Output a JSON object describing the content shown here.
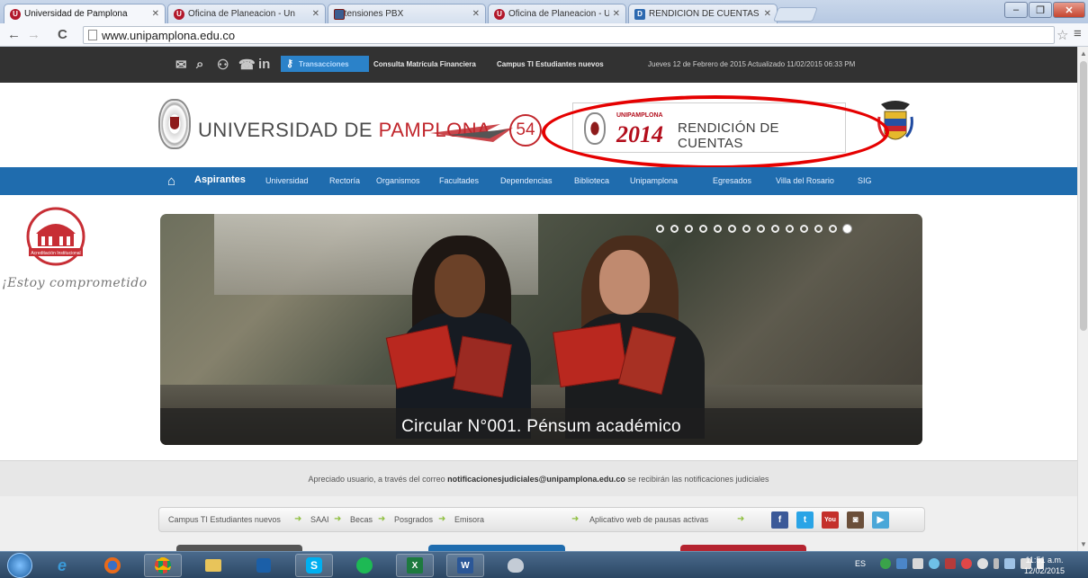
{
  "browser": {
    "tabs": [
      {
        "label": "Universidad de Pamplona",
        "active": true
      },
      {
        "label": "Oficina de Planeacion - Un",
        "active": false
      },
      {
        "label": "Extensiones PBX",
        "active": false
      },
      {
        "label": "Oficina de Planeacion - Un",
        "active": false
      },
      {
        "label": "RENDICIÓN DE CUENTAS",
        "active": false
      }
    ],
    "url": "www.unipamplona.edu.co",
    "window_buttons": {
      "minimize": "–",
      "maximize": "❐",
      "close": "✕"
    }
  },
  "topbar": {
    "links": [
      "Transacciones",
      "Consulta Matrícula Financiera",
      "Campus TI Estudiantes nuevos"
    ],
    "date_text": "Jueves 12 de Febrero de 2015   Actualizado 11/02/2015 06:33 PM"
  },
  "header": {
    "uni_name_prefix": "UNIVERSIDAD DE ",
    "uni_name_suffix": "PAMPLONA",
    "anniversary": "54",
    "banner": {
      "brand": "UNIPAMPLONA",
      "year": "2014",
      "title": "RENDICIÓN DE CUENTAS"
    }
  },
  "nav": {
    "items": [
      "Aspirantes",
      "Universidad",
      "Rectoría",
      "Organismos",
      "Facultades",
      "Dependencias",
      "Biblioteca",
      "Unipamplona",
      "Egresados",
      "Villa del Rosario",
      "SIG"
    ],
    "active_index": 0
  },
  "sidebar": {
    "logo_text": "Acreditación Institucional",
    "tagline": "¡Estoy comprometido"
  },
  "slider": {
    "caption": "Circular N°001. Pénsum académico",
    "dot_count": 14,
    "active_dot": 13
  },
  "notice": {
    "prefix": "Apreciado usuario, a través del correo ",
    "email": "notificacionesjudiciales@unipamplona.edu.co",
    "suffix": " se recibirán las notificaciones judiciales"
  },
  "quicklinks": {
    "items": [
      "Campus TI Estudiantes nuevos",
      "SAAI",
      "Becas",
      "Posgrados",
      "Emisora",
      "Aplicativo web de pausas activas"
    ]
  },
  "social": [
    {
      "name": "facebook-icon",
      "glyph": "f",
      "color": "#3b5998"
    },
    {
      "name": "twitter-icon",
      "glyph": "t",
      "color": "#2aa4e6"
    },
    {
      "name": "youtube-icon",
      "glyph": "You",
      "color": "#c4302b"
    },
    {
      "name": "instagram-icon",
      "glyph": "◙",
      "color": "#6b4f3a"
    },
    {
      "name": "play-icon",
      "glyph": "▶",
      "color": "#4aa7d8"
    }
  ],
  "taskbar": {
    "lang": "ES",
    "clock_time": "11:51 a.m.",
    "clock_date": "12/02/2015"
  }
}
